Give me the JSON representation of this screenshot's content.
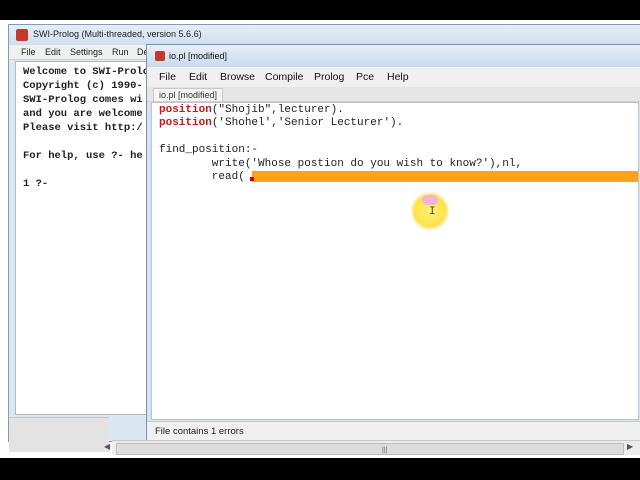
{
  "console_window": {
    "title": "SWI-Prolog (Multi-threaded, version 5.6.6)",
    "menu": [
      "File",
      "Edit",
      "Settings",
      "Run",
      "De"
    ],
    "lines": [
      "Welcome to SWI-Prolo",
      "Copyright (c) 1990-",
      "SWI-Prolog comes wi",
      "and you are welcome",
      "Please visit http:/",
      "",
      "For help, use ?- he",
      "",
      "1 ?-"
    ]
  },
  "editor_window": {
    "title": "io.pl [modified]",
    "menu": [
      "File",
      "Edit",
      "Browse",
      "Compile",
      "Prolog",
      "Pce",
      "Help"
    ],
    "tab": "io.pl [modified]",
    "code": {
      "l1_kw": "position",
      "l1_rest": "(\"Shojib\",lecturer).",
      "l2_kw": "position",
      "l2_rest": "('Shohel','Senior Lecturer').",
      "l4": "find_position:-",
      "l5": "        write('Whose postion do you wish to know?'),nl,",
      "l6": "        read("
    },
    "status": "File contains 1 errors",
    "cursor_glyph": "I"
  },
  "colors": {
    "keyword": "#c21a1a",
    "highlight": "#ffa21a",
    "cursor_spot": "#ffe04d"
  }
}
